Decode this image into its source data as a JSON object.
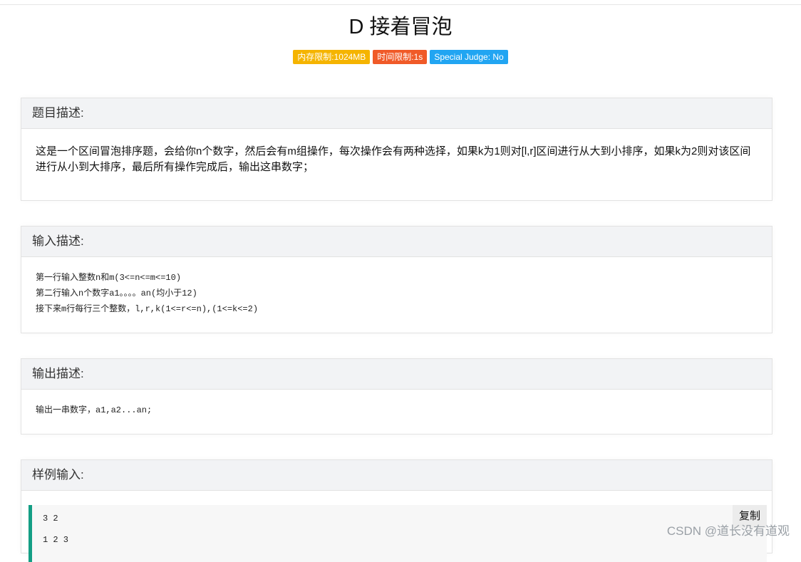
{
  "problem": {
    "title": "D 接着冒泡",
    "badges": {
      "memory": "内存限制:1024MB",
      "time": "时间限制:1s",
      "judge": "Special Judge: No"
    }
  },
  "sections": {
    "description": {
      "heading": "题目描述:",
      "text": "这是一个区间冒泡排序题，会给你n个数字，然后会有m组操作，每次操作会有两种选择，如果k为1则对[l,r]区间进行从大到小排序，如果k为2则对该区间进行从小到大排序，最后所有操作完成后，输出这串数字；"
    },
    "input": {
      "heading": "输入描述:",
      "lines": [
        "第一行输入整数n和m(3<=n<=m<=10)",
        "第二行输入n个数字a1。。。。an(均小于12)",
        "接下来m行每行三个整数，l,r,k(1<=r<=n),(1<=k<=2)"
      ]
    },
    "output": {
      "heading": "输出描述:",
      "text": "输出一串数字，a1,a2...an;"
    },
    "sample_input": {
      "heading": "样例输入:",
      "copy_label": "复制",
      "lines": [
        "3 2",
        "1 2 3"
      ]
    }
  },
  "watermark": "CSDN @道长没有道观",
  "colors": {
    "memory_badge": "#f5b400",
    "time_badge": "#f05a28",
    "judge_badge": "#21a5f2",
    "sample_accent": "#139e84"
  }
}
